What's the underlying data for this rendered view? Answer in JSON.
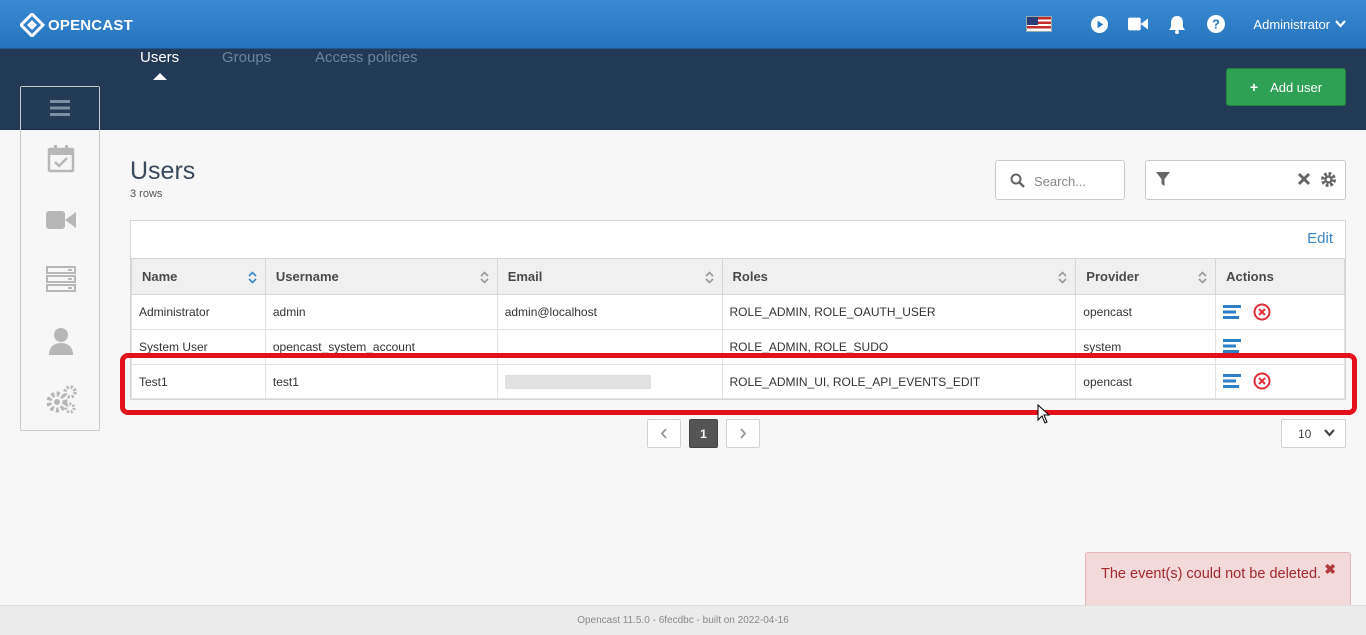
{
  "app": {
    "name": "OPENCAST"
  },
  "header": {
    "language": "English (US)",
    "user_label": "Administrator"
  },
  "nav": {
    "tabs": [
      {
        "label": "Users",
        "active": true
      },
      {
        "label": "Groups",
        "active": false
      },
      {
        "label": "Access policies",
        "active": false
      }
    ],
    "add_button_label": "Add user"
  },
  "sidebar": {
    "items": [
      "menu-icon",
      "calendar-check-icon",
      "video-camera-icon",
      "server-rack-icon",
      "user-icon",
      "gears-icon"
    ]
  },
  "main": {
    "title": "Users",
    "row_count": "3 rows",
    "search_placeholder": "Search...",
    "edit_label": "Edit",
    "columns": [
      "Name",
      "Username",
      "Email",
      "Roles",
      "Provider",
      "Actions"
    ],
    "rows": [
      {
        "name": "Administrator",
        "username": "admin",
        "email": "admin@localhost",
        "roles": "ROLE_ADMIN, ROLE_OAUTH_USER",
        "provider": "opencast"
      },
      {
        "name": "System User",
        "username": "opencast_system_account",
        "email": "",
        "roles": "ROLE_ADMIN, ROLE_SUDO",
        "provider": "system"
      },
      {
        "name": "Test1",
        "username": "test1",
        "email": "",
        "roles": "ROLE_ADMIN_UI, ROLE_API_EVENTS_EDIT",
        "provider": "opencast"
      }
    ]
  },
  "pagination": {
    "current_page": "1",
    "page_size": "10"
  },
  "toast": {
    "message": "The event(s) could not be deleted."
  },
  "footer": {
    "text": "Opencast 11.5.0 - 6fecdbc - built on 2022-04-16"
  },
  "colors": {
    "header_blue": "#2f80c9",
    "nav_dark": "#223a55",
    "add_green": "#2fa154",
    "highlight_red": "#e3101a",
    "link_blue": "#3a87c7",
    "delete_red": "#e02e38"
  }
}
